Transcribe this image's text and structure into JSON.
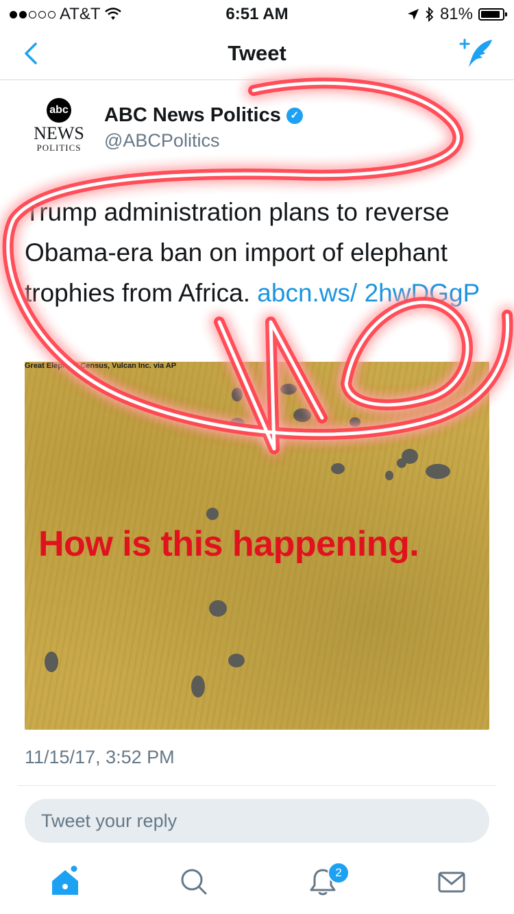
{
  "status_bar": {
    "carrier": "AT&T",
    "time": "6:51 AM",
    "battery": "81%"
  },
  "nav": {
    "title": "Tweet"
  },
  "tweet": {
    "avatar_logo": "abc",
    "avatar_line1": "NEWS",
    "avatar_line2": "POLITICS",
    "author_name": "ABC News Politics",
    "author_handle": "@ABCPolitics",
    "text": "Trump administration plans to reverse Obama-era ban on import of elephant trophies from Africa.",
    "link_text": "abcn.ws/ 2hwDGgP",
    "media_credit": "Great Elephant Census, Vulcan Inc. via AP",
    "media_overlay_text": "How is this happening.",
    "timestamp": "11/15/17, 3:52 PM"
  },
  "reply": {
    "placeholder": "Tweet your reply"
  },
  "tabbar": {
    "notifications_badge": "2"
  },
  "annotation": {
    "scribble_text": "NO",
    "color": "#ff2a3d"
  },
  "colors": {
    "accent": "#1da1f2",
    "link": "#1b95e0",
    "overlay_red": "#e0121e"
  }
}
